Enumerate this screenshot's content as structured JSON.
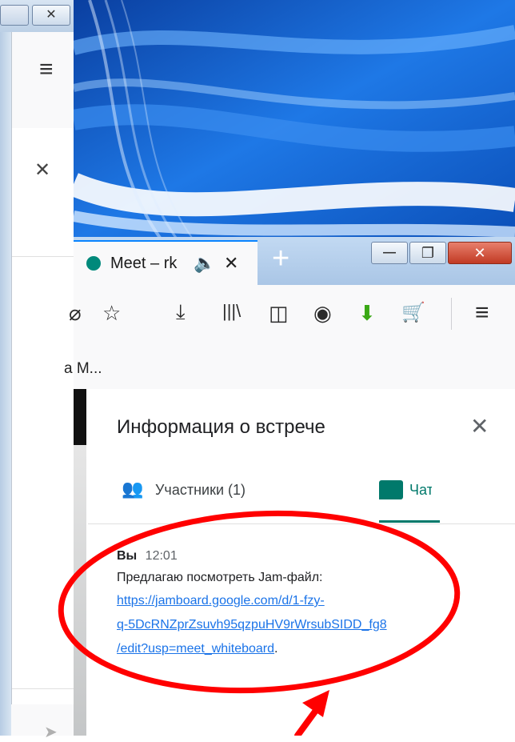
{
  "background_window": {
    "close_glyph": "✕",
    "menu_glyph": "≡",
    "panel_close_glyph": "✕",
    "send_glyph": "➤"
  },
  "browser": {
    "tab": {
      "title": "Meet – rk",
      "close_glyph": "✕",
      "new_tab_glyph": "+"
    },
    "window_controls": {
      "minimize": "—",
      "restore": "❐",
      "close": "✕"
    },
    "toolbar_icons": [
      "pocket-icon",
      "star-icon",
      "download-icon",
      "library-icon",
      "sidebar-icon",
      "account-icon",
      "green-arrow-extension-icon",
      "cart-extension-icon",
      "menu-icon"
    ],
    "bookmark_text": "a M..."
  },
  "meet": {
    "panel_title": "Информация о встрече",
    "close_glyph": "✕",
    "tabs": [
      {
        "label": "Участники (1)"
      },
      {
        "label": "Чат"
      }
    ],
    "message": {
      "sender": "Вы",
      "time": "12:01",
      "text": "Предлагаю посмотреть Jam-файл:",
      "link_line1": "https://jamboard.google.com/d/1-fzy-",
      "link_line2": "q-5DcRNZprZsuvh95qzpuHV9rWrsubSIDD_fg8",
      "link_line3": "/edit?usp=meet_whiteboard",
      "link_end": "."
    }
  },
  "annotation": {
    "color": "#ff0000"
  },
  "colors": {
    "link": "#1a73e8",
    "meet_green": "#00796b",
    "firefox_blue": "#0a84ff"
  }
}
